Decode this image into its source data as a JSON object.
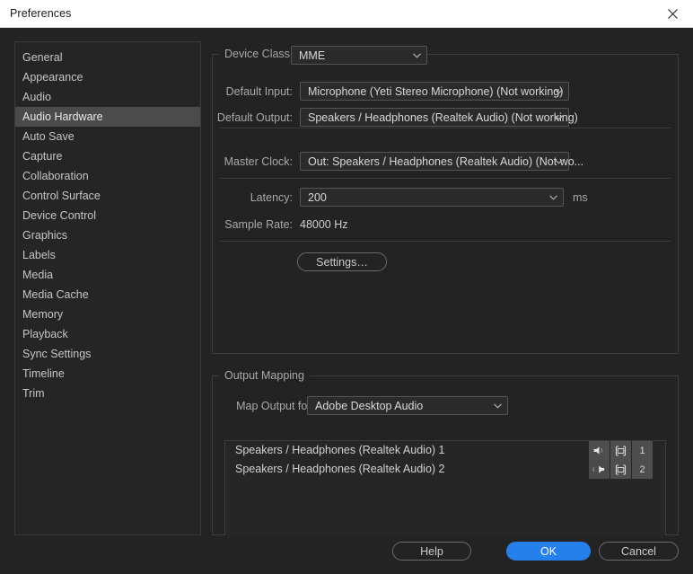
{
  "window": {
    "title": "Preferences",
    "close_icon": "close-icon"
  },
  "sidebar": {
    "items": [
      {
        "label": "General",
        "selected": false
      },
      {
        "label": "Appearance",
        "selected": false
      },
      {
        "label": "Audio",
        "selected": false
      },
      {
        "label": "Audio Hardware",
        "selected": true
      },
      {
        "label": "Auto Save",
        "selected": false
      },
      {
        "label": "Capture",
        "selected": false
      },
      {
        "label": "Collaboration",
        "selected": false
      },
      {
        "label": "Control Surface",
        "selected": false
      },
      {
        "label": "Device Control",
        "selected": false
      },
      {
        "label": "Graphics",
        "selected": false
      },
      {
        "label": "Labels",
        "selected": false
      },
      {
        "label": "Media",
        "selected": false
      },
      {
        "label": "Media Cache",
        "selected": false
      },
      {
        "label": "Memory",
        "selected": false
      },
      {
        "label": "Playback",
        "selected": false
      },
      {
        "label": "Sync Settings",
        "selected": false
      },
      {
        "label": "Timeline",
        "selected": false
      },
      {
        "label": "Trim",
        "selected": false
      }
    ]
  },
  "device_group": {
    "legend": "Device Class",
    "device_class": {
      "label": "Device Class:",
      "value": "MME"
    },
    "default_input": {
      "label": "Default Input:",
      "value": "Microphone (Yeti Stereo Microphone) (Not working)"
    },
    "default_output": {
      "label": "Default Output:",
      "value": "Speakers / Headphones (Realtek Audio) (Not working)"
    },
    "master_clock": {
      "label": "Master Clock:",
      "value": "Out: Speakers / Headphones (Realtek Audio) (Not wo..."
    },
    "latency": {
      "label": "Latency:",
      "value": "200",
      "unit": "ms"
    },
    "sample_rate": {
      "label": "Sample Rate:",
      "value": "48000 Hz"
    },
    "settings_button": "Settings…"
  },
  "output_group": {
    "legend": "Output Mapping",
    "map_output_for": {
      "label": "Map Output for:",
      "value": "Adobe Desktop Audio"
    },
    "rows": [
      {
        "name": "Speakers / Headphones (Realtek Audio) 1",
        "speaker_icon": "speaker-left-icon",
        "device_icon": "output-device-icon",
        "channel": "1"
      },
      {
        "name": "Speakers / Headphones (Realtek Audio) 2",
        "speaker_icon": "speaker-right-icon",
        "device_icon": "output-device-icon",
        "channel": "2"
      }
    ]
  },
  "footer": {
    "help": "Help",
    "ok": "OK",
    "cancel": "Cancel"
  },
  "colors": {
    "accent": "#2680eb",
    "window_bg": "#232323",
    "titlebar_bg": "#ffffff",
    "selection": "#4b4b4b"
  }
}
